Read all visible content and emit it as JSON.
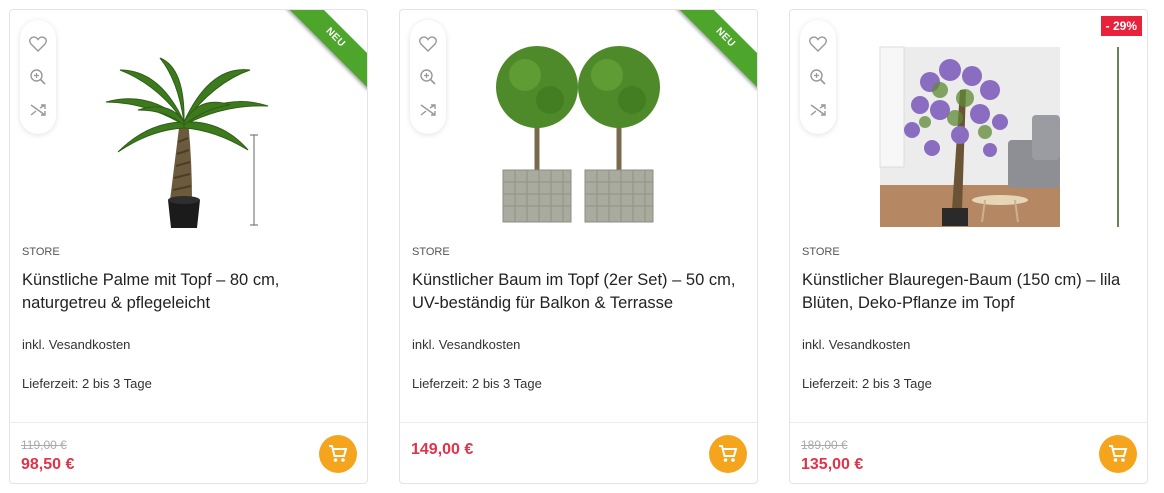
{
  "colors": {
    "accent_price": "#e2324a",
    "cart_button": "#f5a41e",
    "new_ribbon": "#4ea52c",
    "discount_badge": "#e8223b"
  },
  "products": [
    {
      "brand": "STORE",
      "title": "Künstliche Palme mit Topf – 80 cm, naturgetreu & pflegeleicht",
      "shipping": "inkl. Vesandkosten",
      "delivery": "Lieferzeit: 2 bis 3 Tage",
      "old_price": "119,00 €",
      "price": "98,50 €",
      "badge": "NEU",
      "image": "artificial-palm-in-pot"
    },
    {
      "brand": "STORE",
      "title": "Künstlicher Baum im Topf (2er Set) – 50 cm, UV-beständig für Balkon & Terrasse",
      "shipping": "inkl. Vesandkosten",
      "delivery": "Lieferzeit: 2 bis 3 Tage",
      "price": "149,00 €",
      "badge": "NEU",
      "image": "two-boxwood-ball-trees"
    },
    {
      "brand": "STORE",
      "title": "Künstlicher Blauregen-Baum (150 cm) – lila Blüten, Deko-Pflanze im Topf",
      "shipping": "inkl. Vesandkosten",
      "delivery": "Lieferzeit: 2 bis 3 Tage",
      "old_price": "189,00 €",
      "price": "135,00 €",
      "badge": "- 29%",
      "image": "wisteria-tree-living-room"
    }
  ],
  "icons": {
    "wishlist": "heart-icon",
    "quickview": "zoom-icon",
    "compare": "shuffle-icon",
    "cart": "cart-icon"
  }
}
